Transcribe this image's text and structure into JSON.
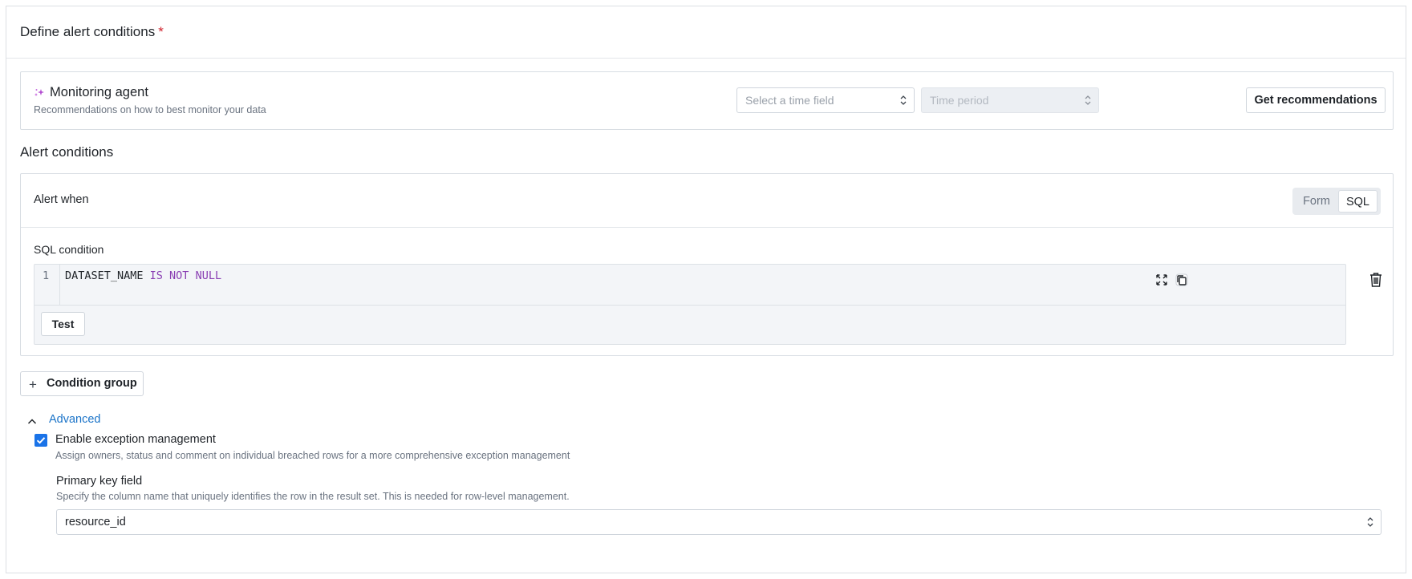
{
  "header": {
    "title": "Define alert conditions",
    "required_mark": "*"
  },
  "agent": {
    "title": "Monitoring agent",
    "subtitle": "Recommendations on how to best monitor your data",
    "time_field_placeholder": "Select a time field",
    "time_period_placeholder": "Time period",
    "recommend_button": "Get recommendations",
    "icon": "sparkle-icon"
  },
  "conditions": {
    "section_title": "Alert conditions",
    "alert_when": "Alert when",
    "mode_options": [
      "Form",
      "SQL"
    ],
    "mode_selected": "SQL",
    "sql_label": "SQL condition",
    "editor": {
      "line_number": "1",
      "code_plain": "DATASET_NAME ",
      "code_keyword": "IS NOT NULL",
      "keyword_color": "#8a3fb3"
    },
    "test_button": "Test",
    "condition_group_button": "Condition group"
  },
  "advanced": {
    "label": "Advanced",
    "expanded": true,
    "exception_checkbox": {
      "label": "Enable exception management",
      "description": "Assign owners, status and comment on individual breached rows for a more comprehensive exception management",
      "checked": true
    },
    "primary_key": {
      "label": "Primary key field",
      "description": "Specify the column name that uniquely identifies the row in the result set. This is needed for row-level management.",
      "value": "resource_id"
    }
  },
  "colors": {
    "accent": "#1a73e8",
    "link": "#1a73c8",
    "required": "#d1242f"
  }
}
